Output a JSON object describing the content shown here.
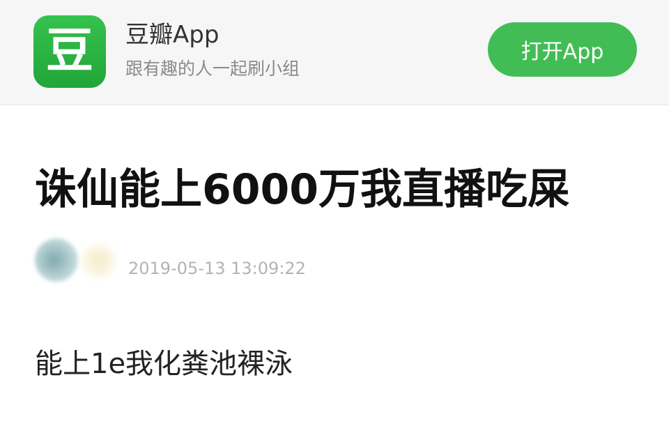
{
  "banner": {
    "logo_char": "豆",
    "app_name": "豆瓣App",
    "slogan": "跟有趣的人一起刷小组",
    "open_button_label": "打开App",
    "accent_color": "#42bd56"
  },
  "post": {
    "title": "诛仙能上6000万我直播吃屎",
    "timestamp": "2019-05-13 13:09:22",
    "body": "能上1e我化粪池裸泳"
  }
}
